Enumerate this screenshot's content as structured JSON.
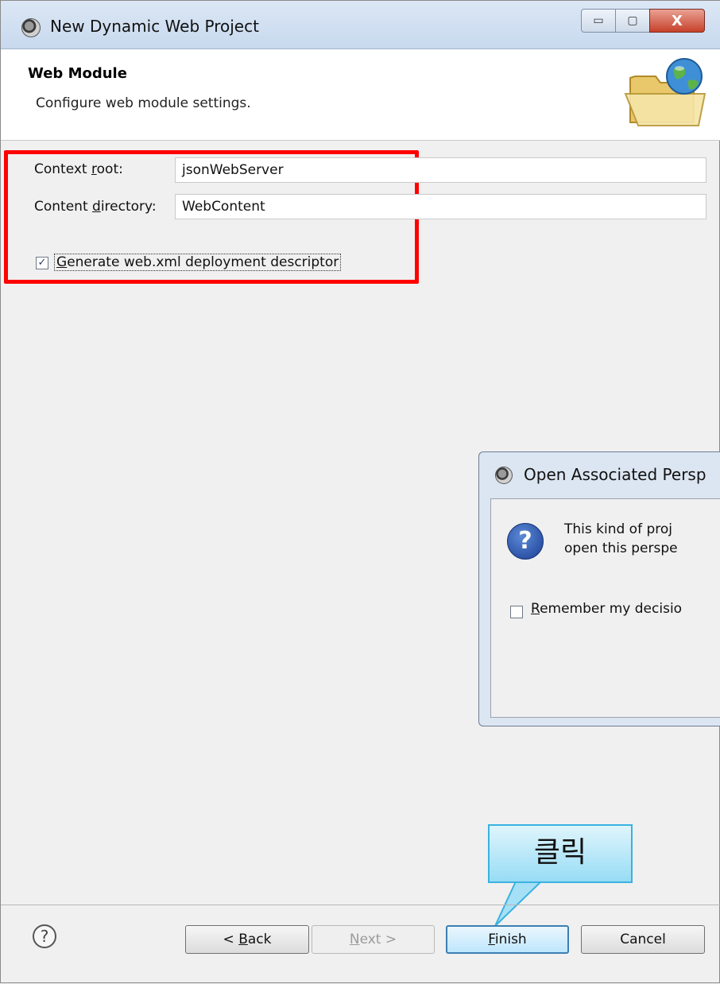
{
  "window": {
    "title": "New Dynamic Web Project",
    "controls": {
      "minimize": "▭",
      "maximize": "▢",
      "close": "X"
    }
  },
  "banner": {
    "title": "Web Module",
    "description": "Configure web module settings.",
    "icon": "folder-globe-icon"
  },
  "form": {
    "context_root": {
      "label_pre": "Context ",
      "label_u": "r",
      "label_post": "oot:",
      "value": "jsonWebServer"
    },
    "content_directory": {
      "label_pre": "Content ",
      "label_u": "d",
      "label_post": "irectory:",
      "value": "WebContent"
    },
    "generate_webxml": {
      "checked": true,
      "check_mark": "✓",
      "label_u": "G",
      "label_post": "enerate web.xml deployment descriptor"
    }
  },
  "highlight": {
    "color": "#ff0000"
  },
  "sub_dialog": {
    "title": "Open Associated Persp",
    "icon": "question-icon",
    "icon_glyph": "?",
    "message_line1": "This kind of proj",
    "message_line2": "open this perspe",
    "remember": {
      "checked": false,
      "label_u": "R",
      "label_post": "emember my decisio"
    }
  },
  "callout": {
    "text": "클릭"
  },
  "footer": {
    "help_glyph": "?",
    "back": {
      "pre": "< ",
      "u": "B",
      "post": "ack"
    },
    "next": {
      "u": "N",
      "post": "ext >"
    },
    "finish": {
      "u": "F",
      "post": "inish"
    },
    "cancel": "Cancel"
  }
}
